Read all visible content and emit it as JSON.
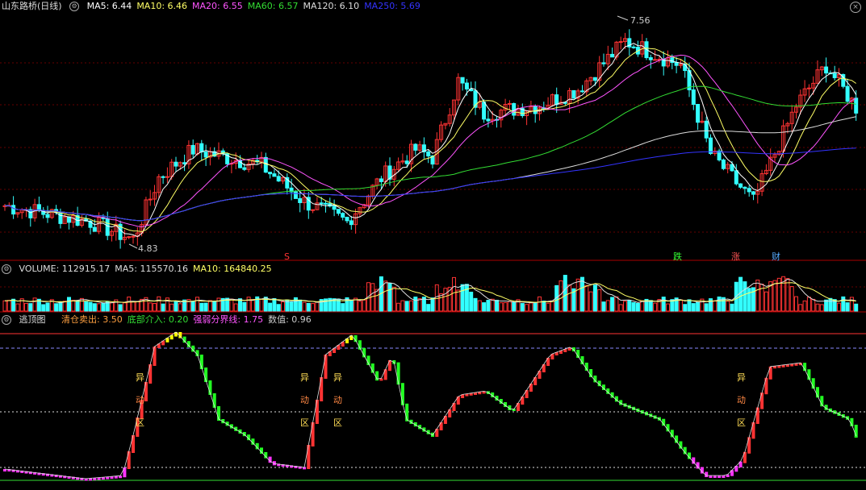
{
  "main": {
    "title": "山东路桥(日线)",
    "ma": [
      {
        "label": "MA5: 6.44",
        "color": "#ffffff"
      },
      {
        "label": "MA10: 6.46",
        "color": "#ffff66"
      },
      {
        "label": "MA20: 6.55",
        "color": "#ff55ff"
      },
      {
        "label": "MA60: 6.57",
        "color": "#33dd33"
      },
      {
        "label": "MA120: 6.10",
        "color": "#dddddd"
      },
      {
        "label": "MA250: 5.69",
        "color": "#3333ff"
      }
    ],
    "high_label": "7.56",
    "low_label": "4.83",
    "markers": [
      "S",
      "跌",
      "涨",
      "财"
    ]
  },
  "volume": {
    "labels": [
      {
        "label": "VOLUME: 112915.17",
        "color": "#dddddd"
      },
      {
        "label": "MA5: 115570.16",
        "color": "#dddddd"
      },
      {
        "label": "MA10: 164840.25",
        "color": "#ffff66"
      }
    ]
  },
  "indicator": {
    "name": "逃顶图",
    "labels": [
      {
        "label": "清仓卖出: 3.50",
        "color": "#ffa040"
      },
      {
        "label": "底部介入: 0.20",
        "color": "#33dd33"
      },
      {
        "label": "强弱分界线: 1.75",
        "color": "#ff55ff"
      },
      {
        "label": "数值: 0.96",
        "color": "#cccccc"
      }
    ],
    "zone_label": [
      "异",
      "动",
      "区"
    ]
  },
  "chart_data": {
    "type": "candlestick",
    "symbol": "山东路桥",
    "period": "日线",
    "price_high": 7.56,
    "price_low": 4.83,
    "colors": {
      "up": "#ff3333",
      "down": "#33ffff",
      "hot": "#ffff00",
      "weak": "#ff33ff",
      "strong": "#22ff22"
    }
  }
}
